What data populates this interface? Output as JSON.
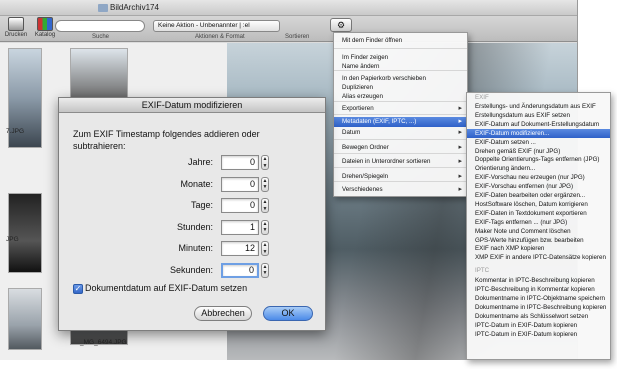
{
  "window": {
    "title": "BildArchiv174"
  },
  "toolbar": {
    "btn_drucken": "Drucken",
    "btn_katalog": "Katalog",
    "search_label": "Suche",
    "action_select_value": "Keine Aktion - Unbenannter | :el",
    "action_label": "Aktionen & Format",
    "gear_label": "Sortieren"
  },
  "files": [
    "7.JPG",
    "JPG",
    "_MG_6494.JPG"
  ],
  "context_menu": {
    "items": [
      {
        "label": "Mit dem Finder öffnen",
        "arrow": false
      },
      {
        "label": "Im Finder zeigen",
        "arrow": false
      },
      {
        "label": "Name ändern",
        "arrow": false
      },
      {
        "label": "In den Papierkorb verschieben",
        "arrow": false
      },
      {
        "label": "Duplizieren",
        "arrow": false
      },
      {
        "label": "Alias erzeugen",
        "arrow": false
      },
      {
        "label": "Exportieren",
        "arrow": true
      },
      {
        "label": "Metadaten (EXIF, IPTC, ...)",
        "arrow": true,
        "selected": true
      },
      {
        "label": "Datum",
        "arrow": true
      },
      {
        "label": "Bewegen Ordner",
        "arrow": true
      },
      {
        "label": "Dateien in Unterordner sortieren",
        "arrow": true
      },
      {
        "label": "Drehen/Spiegeln",
        "arrow": true
      },
      {
        "label": "Verschiedenes",
        "arrow": true
      }
    ]
  },
  "submenu": {
    "header_exif": "EXIF",
    "header_iptc": "IPTC",
    "items": [
      "Erstellungs- und Änderungsdatum aus EXIF",
      "Erstellungsdatum aus EXIF setzen",
      "EXIF-Datum auf Dokument-Erstellungsdatum",
      "EXIF-Datum modifizieren...",
      "EXIF-Datum setzen ...",
      "Drehen gemäß EXIF (nur JPG)",
      "Doppelte Orientierungs-Tags entfernen (JPG)",
      "Orientierung ändern...",
      "EXIF-Vorschau neu erzeugen (nur JPG)",
      "EXIF-Vorschau entfernen (nur JPG)",
      "EXIF-Daten bearbeiten oder ergänzen...",
      "HostSoftware löschen, Datum korrigieren",
      "EXIF-Daten in Textdokument exportieren",
      "EXIF-Tags entfernen ... (nur JPG)",
      "Maker Note und Comment löschen",
      "GPS-Werte hinzufügen bzw. bearbeiten",
      "EXIF nach XMP kopieren",
      "XMP EXIF in andere IPTC-Datensätze kopieren",
      "Kommentar in IPTC-Beschreibung kopieren",
      "IPTC-Beschreibung in Kommentar kopieren",
      "Dokumentname in IPTC-Objektname speichern",
      "Dokumentname in IPTC-Beschreibung kopieren",
      "Dokumentname als Schlüsselwort setzen",
      "IPTC-Datum in EXIF-Datum kopieren",
      "IPTC-Datum in EXIF-Datum kopieren"
    ],
    "selected_index": 3
  },
  "dialog": {
    "title": "EXIF-Datum modifizieren",
    "description": "Zum EXIF Timestamp folgendes addieren oder subtrahieren:",
    "fields": [
      {
        "label": "Jahre:",
        "value": "0"
      },
      {
        "label": "Monate:",
        "value": "0"
      },
      {
        "label": "Tage:",
        "value": "0"
      },
      {
        "label": "Stunden:",
        "value": "1"
      },
      {
        "label": "Minuten:",
        "value": "12"
      },
      {
        "label": "Sekunden:",
        "value": "0"
      }
    ],
    "checkbox_label": "Dokumentdatum auf EXIF-Datum setzen",
    "checkbox_checked": true,
    "cancel_label": "Abbrechen",
    "ok_label": "OK"
  },
  "icons": {
    "stepper_up": "▲",
    "stepper_down": "▼",
    "checkmark": "✓",
    "gear": "⚙"
  }
}
